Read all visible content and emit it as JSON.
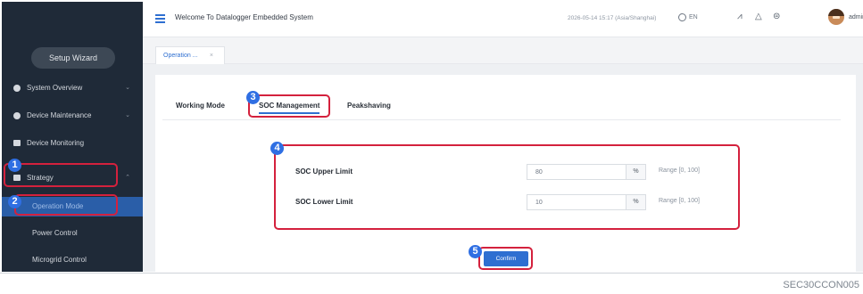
{
  "sidebar": {
    "setup_wizard": "Setup Wizard",
    "items": [
      {
        "label": "System Overview",
        "chevron": "⌄"
      },
      {
        "label": "Device Maintenance",
        "chevron": "⌄"
      },
      {
        "label": "Device Monitoring"
      },
      {
        "label": "Strategy",
        "chevron": "⌃"
      }
    ],
    "sub_items": [
      {
        "label": "Operation Mode",
        "active": true
      },
      {
        "label": "Power Control"
      },
      {
        "label": "Microgrid Control"
      }
    ]
  },
  "topbar": {
    "title": "Welcome To Datalogger Embedded System",
    "datetime": "2026-05-14 15:17 (Asia/Shanghai)",
    "language": "EN",
    "icons": [
      "chart-icon",
      "alert-icon",
      "settings-circle-icon"
    ],
    "username": "admin"
  },
  "tab_strip": {
    "tab_label": "Operation ...",
    "close": "×"
  },
  "content_tabs": [
    "Working Mode",
    "SOC Management",
    "Peakshaving"
  ],
  "active_tab": "SOC Management",
  "form": {
    "fields": [
      {
        "label": "SOC Upper Limit",
        "value": "80",
        "unit": "%",
        "range": "Range [0, 100]"
      },
      {
        "label": "SOC Lower Limit",
        "value": "10",
        "unit": "%",
        "range": "Range [0, 100]"
      }
    ],
    "confirm_label": "Confirm"
  },
  "annotations": {
    "steps": [
      "1",
      "2",
      "3",
      "4",
      "5"
    ],
    "highlight_color": "#d4213d",
    "step_badge_color": "#2f6fe3"
  },
  "doc_code": "SEC30CCON005",
  "colors": {
    "sidebar_bg": "#1f2a38",
    "accent": "#2e6fd1",
    "active_sub_bg": "#2a5ea8"
  }
}
